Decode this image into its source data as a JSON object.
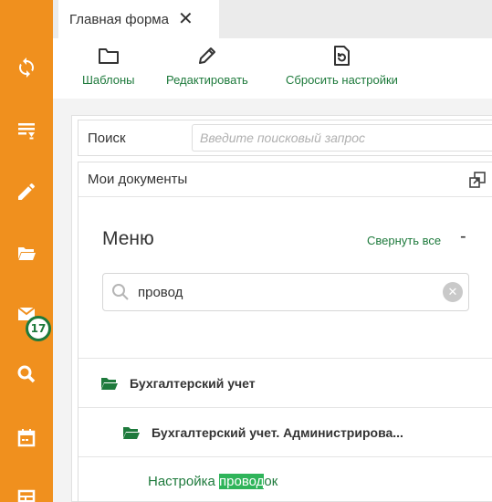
{
  "colors": {
    "sidebar": "#f0901e",
    "accent": "#1e7a3c",
    "highlight": "#2fb45a"
  },
  "sidebar": {
    "items": [
      {
        "icon": "sync-icon"
      },
      {
        "icon": "list-download-icon"
      },
      {
        "icon": "pencil-icon"
      },
      {
        "icon": "folder-open-icon"
      },
      {
        "icon": "mail-icon",
        "badge": "17"
      },
      {
        "icon": "search-icon"
      },
      {
        "icon": "calendar-icon"
      },
      {
        "icon": "grid-icon"
      }
    ]
  },
  "tabs": [
    {
      "label": "Главная форма"
    }
  ],
  "toolbar": {
    "templates_label": "Шаблоны",
    "edit_label": "Редактировать",
    "reset_label": "Сбросить настройки"
  },
  "search": {
    "label": "Поиск",
    "placeholder": "Введите поисковый запрос"
  },
  "documents": {
    "title": "Мои документы"
  },
  "menu": {
    "title": "Меню",
    "collapse_all": "Свернуть все",
    "collapse_symbol": "-",
    "search_value": "провод",
    "tree": [
      {
        "label": "Бухгалтерский учет",
        "level": 1
      },
      {
        "label": "Бухгалтерский учет. Администрирова...",
        "level": 2
      },
      {
        "label_prefix": "Настройка ",
        "label_match": "провод",
        "label_suffix": "ок",
        "level": 3
      }
    ]
  }
}
